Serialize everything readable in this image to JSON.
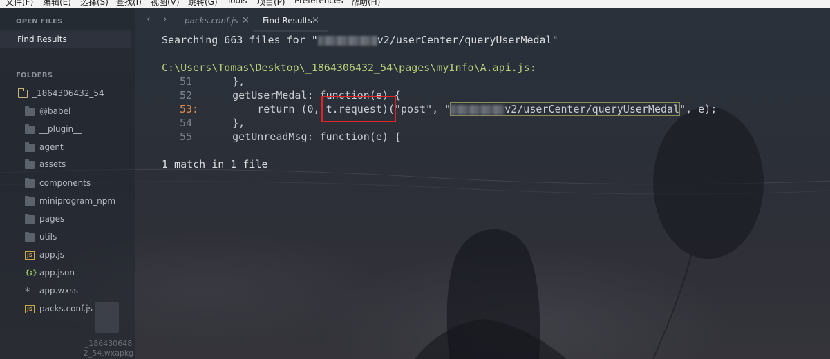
{
  "menubar": {
    "items": [
      "文件(F)",
      "编辑(E)",
      "选择(S)",
      "查找(I)",
      "视图(V)",
      "跳转(G)",
      "Tools",
      "项目(P)",
      "Preferences",
      "帮助(H)"
    ]
  },
  "sidebar": {
    "open_files_title": "OPEN FILES",
    "open_files": [
      "Find Results"
    ],
    "folders_title": "FOLDERS",
    "root_folder": "_1864306432_54",
    "items": [
      {
        "label": "@babel",
        "icon": "folder-icon"
      },
      {
        "label": "__plugin__",
        "icon": "folder-icon"
      },
      {
        "label": "agent",
        "icon": "folder-icon"
      },
      {
        "label": "assets",
        "icon": "folder-icon"
      },
      {
        "label": "components",
        "icon": "folder-icon"
      },
      {
        "label": "miniprogram_npm",
        "icon": "folder-icon"
      },
      {
        "label": "pages",
        "icon": "folder-icon"
      },
      {
        "label": "utils",
        "icon": "folder-icon"
      },
      {
        "label": "app.js",
        "icon": "js-file-icon",
        "glyph": "JS"
      },
      {
        "label": "app.json",
        "icon": "json-file-icon",
        "glyph": "{;}"
      },
      {
        "label": "app.wxss",
        "icon": "asterisk-icon",
        "glyph": "*"
      },
      {
        "label": "packs.conf.js",
        "icon": "js-file-icon",
        "glyph": "JS"
      }
    ],
    "desktop_ghost_label": "_186430648 2_54.wxapkg"
  },
  "tabs": {
    "back_glyph": "‹",
    "forward_glyph": "›",
    "close_glyph": "×",
    "items": [
      {
        "label": "packs.conf.js",
        "active": false
      },
      {
        "label": "Find Results",
        "active": true
      }
    ]
  },
  "results": {
    "search_prefix": "Searching 663 files for \"",
    "search_suffix": "v2/userCenter/queryUserMedal\"",
    "file_path": "C:\\Users\\Tomas\\Desktop\\_1864306432_54\\pages\\myInfo\\A.api.js:",
    "lines": [
      {
        "num": "51",
        "code": "    },"
      },
      {
        "num": "52",
        "code": "    getUserMedal: function(e) {"
      },
      {
        "num": "53:",
        "code_before": "        return (0, ",
        "code_request": "t.request",
        "code_mid": ")(\"post\", \"",
        "code_url": "v2/userCenter/queryUserMedal",
        "code_after": "\", e);"
      },
      {
        "num": "54",
        "code": "    },"
      },
      {
        "num": "55",
        "code": "    getUnreadMsg: function(e) {"
      }
    ],
    "summary": "1 match in 1 file"
  },
  "colors": {
    "path": "#b8cf7a",
    "match_line_number": "#e08a4c",
    "annotation_box": "#e02424"
  }
}
